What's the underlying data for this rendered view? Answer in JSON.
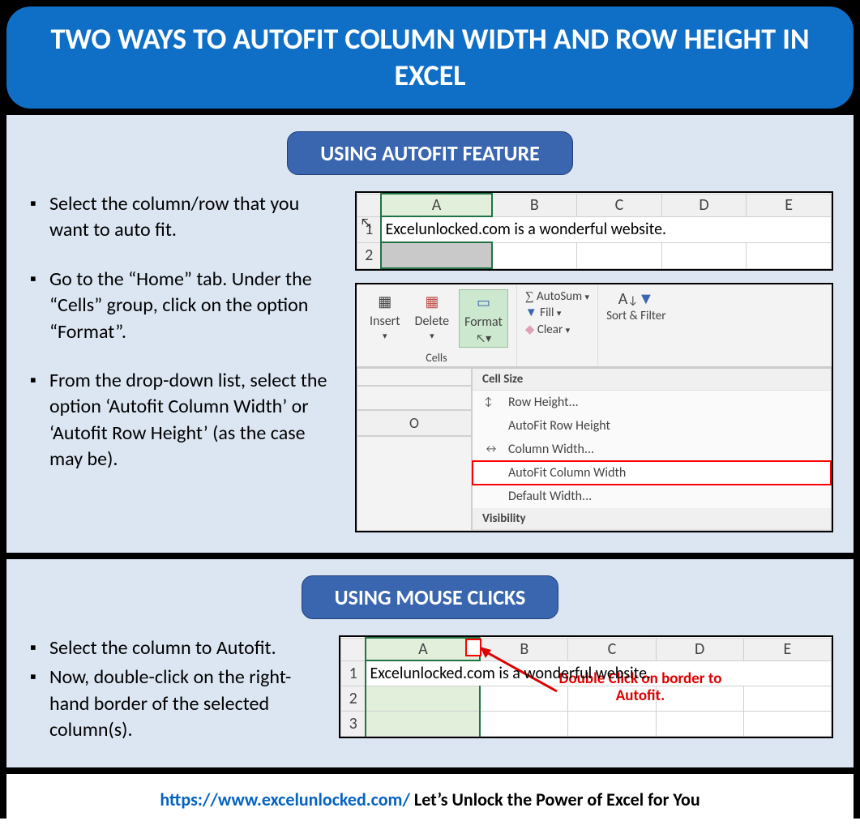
{
  "title": "TWO WAYS TO AUTOFIT COLUMN WIDTH AND ROW HEIGHT IN EXCEL",
  "section1": {
    "label": "USING AUTOFIT FEATURE",
    "bullets": [
      "Select the column/row that you want to auto fit.",
      "Go to the “Home” tab. Under the “Cells” group, click on the option “Format”.",
      "From the drop-down list, select the option ‘Autofit Column Width’ or ‘Autofit Row Height’ (as the case may be)."
    ]
  },
  "section2": {
    "label": "USING MOUSE CLICKS",
    "bullets": [
      "Select the column to Autofit.",
      "Now, double-click on the right-hand border of the selected column(s)."
    ],
    "annotation": "Double Click on border to Autofit."
  },
  "excel": {
    "cols": [
      "A",
      "B",
      "C",
      "D",
      "E"
    ],
    "row_labels": [
      "1",
      "2",
      "3"
    ],
    "cell_text": "Excelunlocked.com is a wonderful website."
  },
  "ribbon": {
    "cells_group": "Cells",
    "insert": "Insert",
    "delete": "Delete",
    "format": "Format",
    "autosum": "AutoSum",
    "fill": "Fill",
    "clear": "Clear",
    "sort_filter": "Sort & Filter",
    "col_o": "O",
    "dd_header1": "Cell Size",
    "dd_row_height": "Row Height...",
    "dd_autofit_row": "AutoFit Row Height",
    "dd_col_width": "Column Width...",
    "dd_autofit_col": "AutoFit Column Width",
    "dd_default_width": "Default Width...",
    "dd_header2": "Visibility"
  },
  "footer": {
    "link_text": "https://www.excelunlocked.com/",
    "tagline": " Let’s Unlock the Power of Excel for You"
  }
}
